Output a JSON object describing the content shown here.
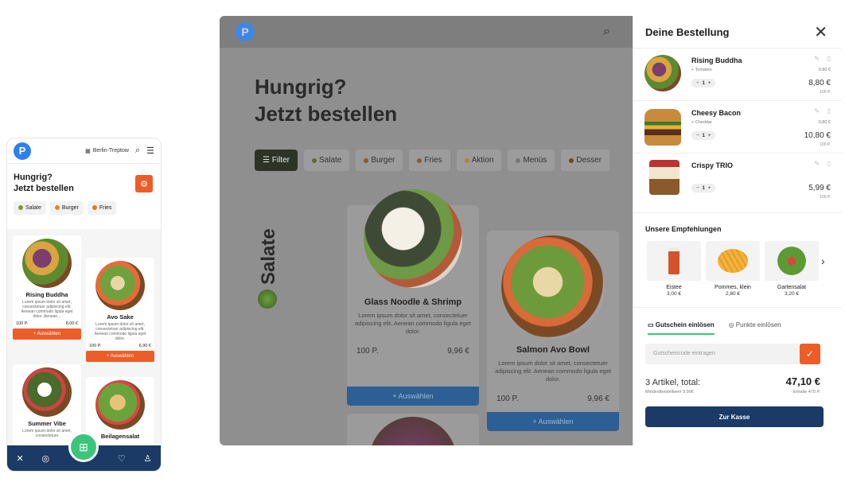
{
  "mobile": {
    "location": "Berlin-Treptow",
    "hero_line1": "Hungrig?",
    "hero_line2": "Jetzt bestellen",
    "chips": [
      {
        "label": "Salate",
        "color": "#7a9a3a"
      },
      {
        "label": "Burger",
        "color": "#d98b2b"
      },
      {
        "label": "Fries",
        "color": "#d97a2b"
      }
    ],
    "cards": [
      {
        "name": "Rising Buddha",
        "desc": "Lorem ipsum dolor sit amet, consectetuer adipiscing elit. Aenean commodo ligula eget dolor. Aenean...",
        "points": "100 P.",
        "price": "8,00 €",
        "button": "+ Auswählen"
      },
      {
        "name": "Avo Sake",
        "desc": "Lorem ipsum dolor sit amet, consectetuer adipiscing elit. Aenean commodo ligula eget dolor.",
        "points": "100 P.",
        "price": "6,90 €",
        "button": "+ Auswählen"
      },
      {
        "name": "Summer Vibe",
        "desc": "Lorem ipsum dolor sit amet, consectetuer"
      },
      {
        "name": "Beilagensalat"
      }
    ]
  },
  "tablet": {
    "hero_line1": "Hungrig?",
    "hero_line2": "Jetzt bestellen",
    "section": "Salate",
    "chips": [
      "Filter",
      "Salate",
      "Burger",
      "Fries",
      "Aktion",
      "Menüs",
      "Desser"
    ],
    "cards": [
      {
        "name": "Glass Noodle & Shrimp",
        "desc": "Lorem ipsum dolor sit amet, consectetuer adipiscing elit. Aenean commodo ligula eget dolor.",
        "points": "100 P.",
        "price": "9,96 €",
        "button": "+ Auswählen"
      },
      {
        "name": "Salmon Avo Bowl",
        "desc": "Lorem ipsum dolor sit amet, consectetuer adipiscing elit. Aenean commodo ligula eget dolor.",
        "points": "100 P.",
        "price": "9,96 €",
        "button": "+ Auswählen"
      }
    ]
  },
  "cart": {
    "title": "Deine Bestellung",
    "items": [
      {
        "name": "Rising Buddha",
        "extra": "+ Tomaten",
        "extra_price": "0,80 €",
        "qty": "1",
        "price": "8,80 €",
        "points": "100 P."
      },
      {
        "name": "Cheesy Bacon",
        "extra": "+ Cheddar",
        "extra_price": "0,80 €",
        "qty": "1",
        "price": "10,80 €",
        "points": "100 P."
      },
      {
        "name": "Crispy TRIO",
        "qty": "1",
        "price": "5,99 €",
        "points": "100 P."
      }
    ],
    "recommend_title": "Unsere Empfehlungen",
    "recommendations": [
      {
        "name": "Eistee",
        "price": "3,00 €"
      },
      {
        "name": "Pommes, klein",
        "price": "2,80 €"
      },
      {
        "name": "Gartensalat",
        "price": "3,20 €"
      }
    ],
    "voucher_tab": "Gutschein einlösen",
    "points_tab": "Punkte einlösen",
    "voucher_placeholder": "Gutscheincode eintragen",
    "summary_label": "3 Artikel, total:",
    "total": "47,10 €",
    "min_order": "Mindestbestellwert 9,90€",
    "earned": "Erhalte 470 P.",
    "checkout": "Zur Kasse"
  },
  "colors": {
    "accent": "#ec5d28",
    "navy": "#1b3a66",
    "brand_blue": "#2f80ed",
    "green": "#3cc57a"
  }
}
